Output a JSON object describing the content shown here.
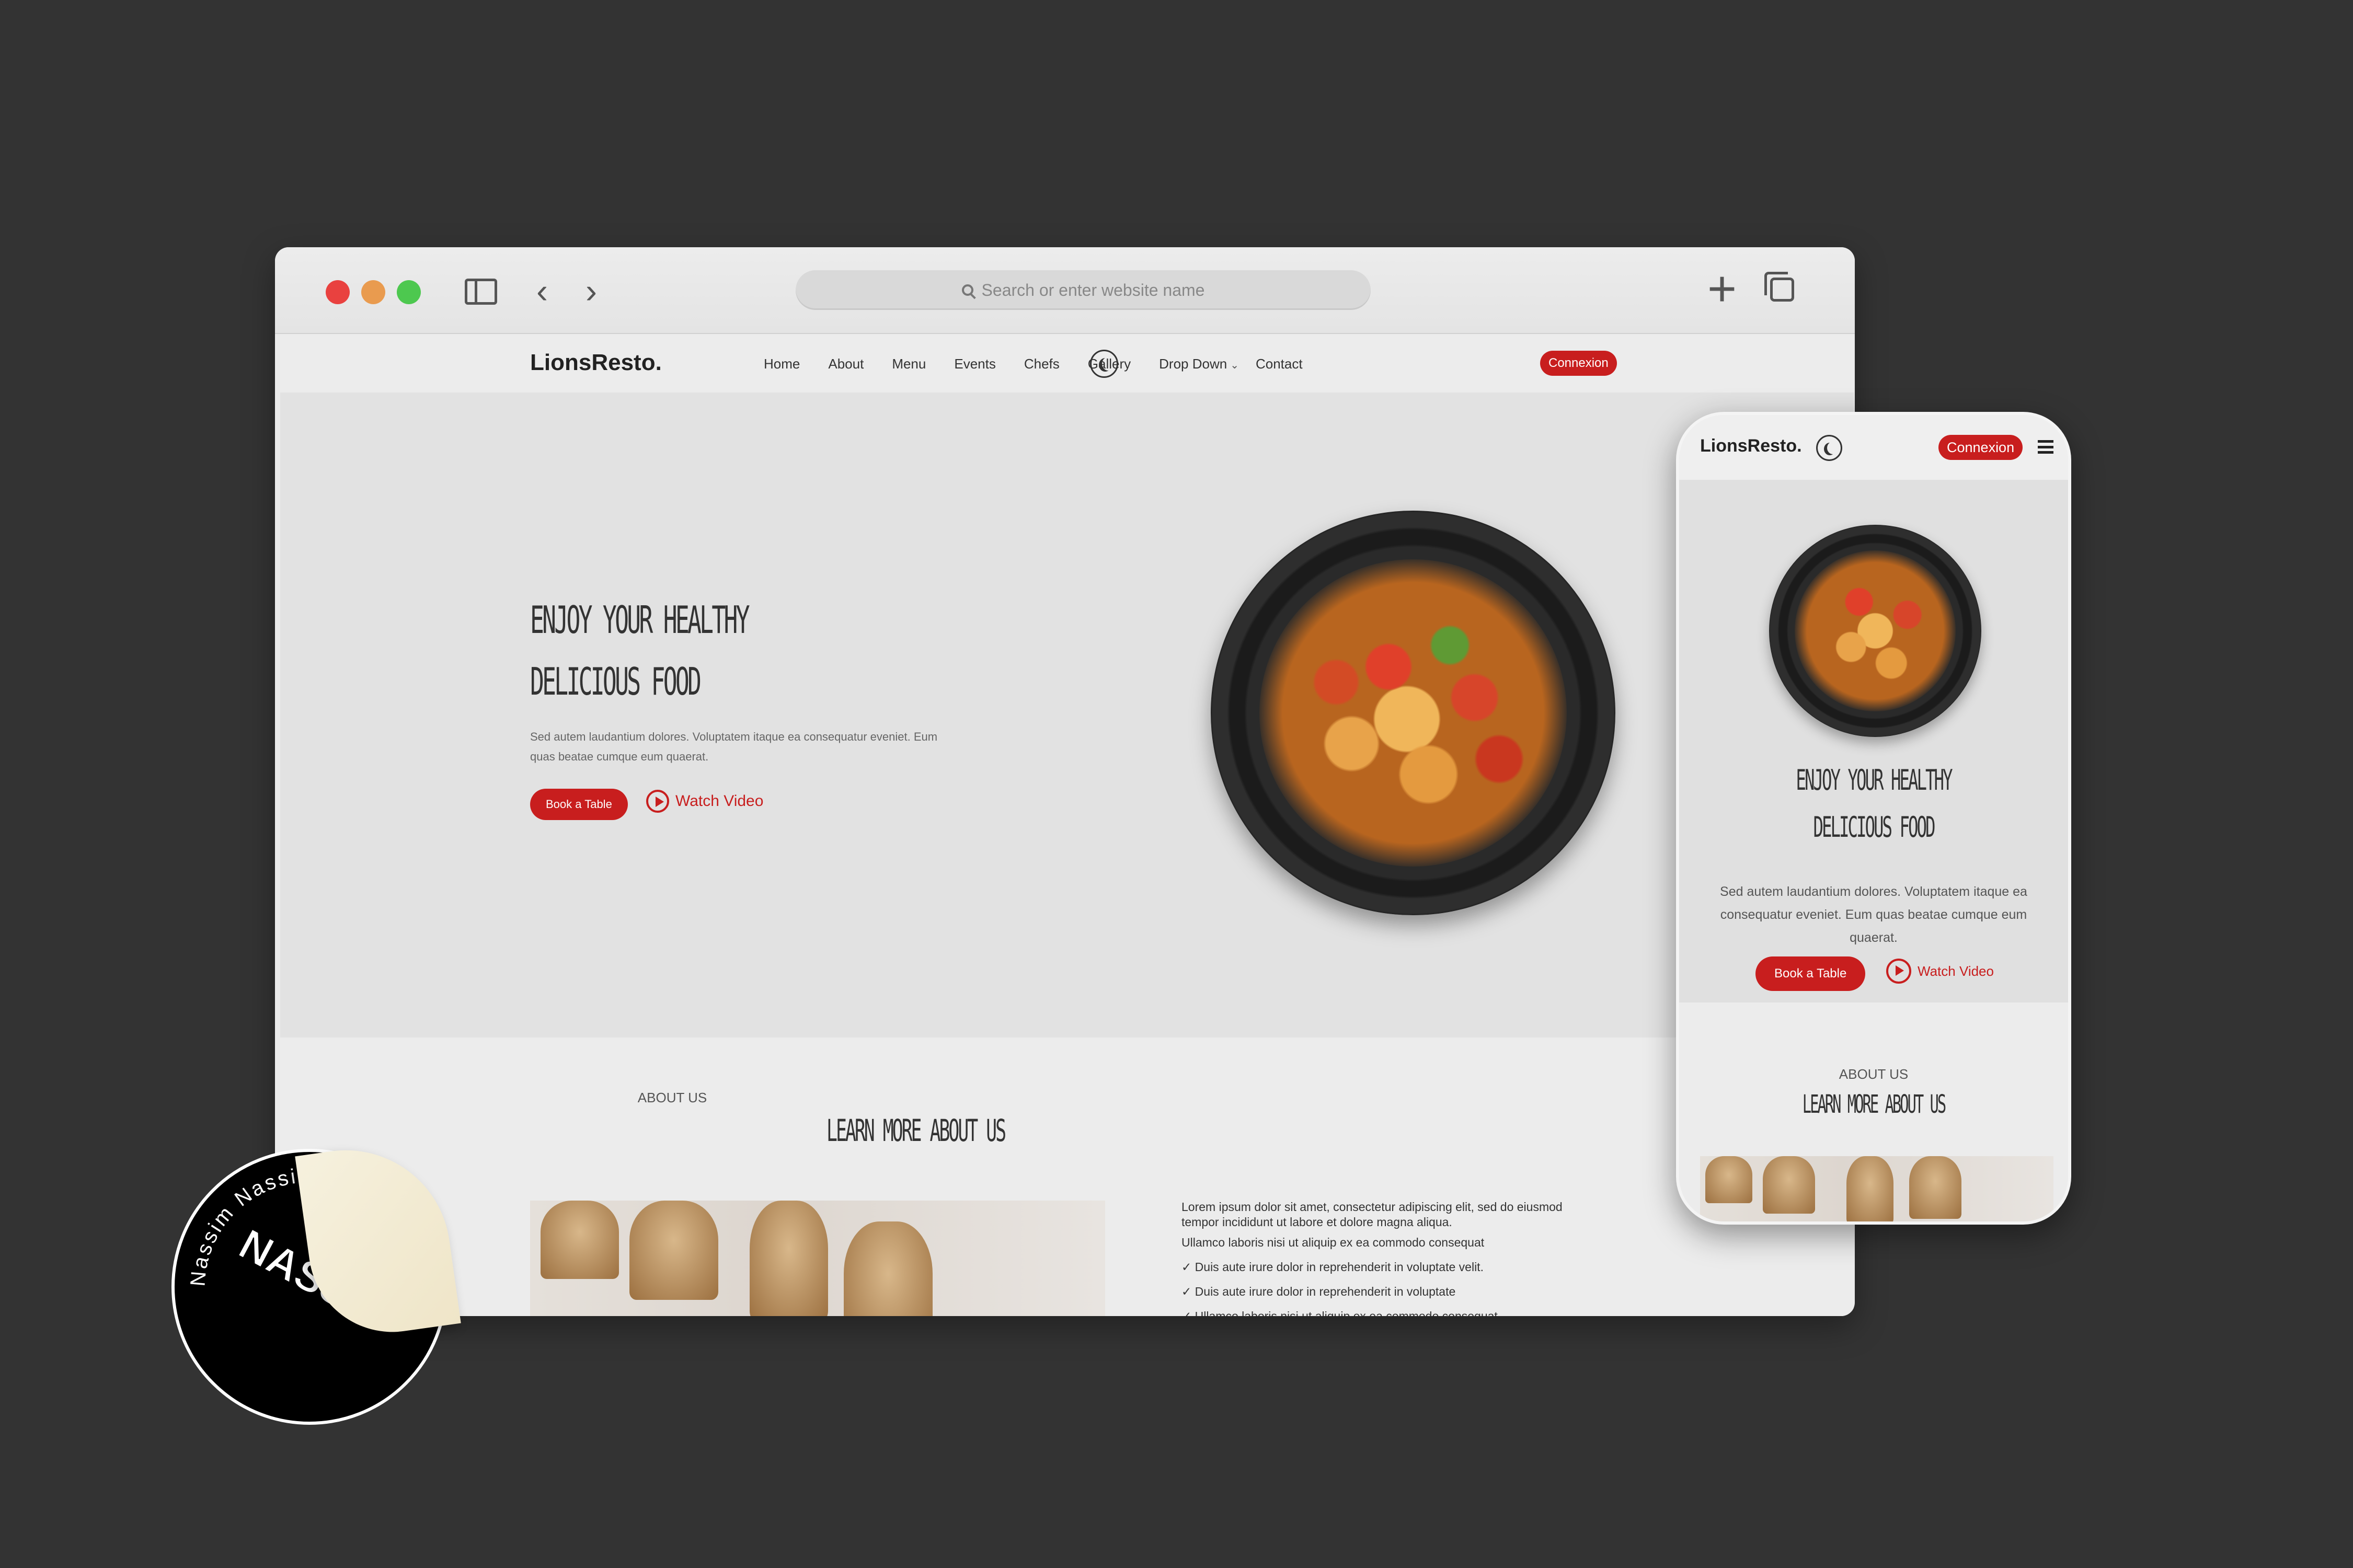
{
  "browser": {
    "address_placeholder": "Search or enter website name",
    "icons": [
      "sidebar-icon",
      "chevron-left-icon",
      "chevron-right-icon",
      "search-icon",
      "plus-icon",
      "tabs-icon"
    ]
  },
  "site": {
    "logo": "LionsResto.",
    "nav": [
      "Home",
      "About",
      "Menu",
      "Events",
      "Chefs",
      "Gallery",
      "Drop Down",
      "Contact"
    ],
    "connexion": "Connexion"
  },
  "hero": {
    "title_line1": "Enjoy Your Healthy",
    "title_line2": "Delicious Food",
    "text": "Sed autem laudantium dolores. Voluptatem itaque ea consequatur eveniet. Eum quas beatae cumque eum quaerat.",
    "book_label": "Book a Table",
    "watch_label": "Watch Video"
  },
  "about": {
    "label": "ABOUT US",
    "title": "Learn More About Us",
    "paragraph": "Lorem ipsum dolor sit amet, consectetur adipiscing elit, sed do eiusmod tempor incididunt ut labore et dolore magna aliqua.",
    "line2": "Ullamco laboris nisi ut aliquip ex ea commodo consequat",
    "check1": "✓ Duis aute irure dolor in reprehenderit in voluptate velit.",
    "check2": "✓ Duis aute irure dolor in reprehenderit in voluptate",
    "check3": "✓ Ullamco laboris nisi ut aliquip ex ea commodo consequat"
  },
  "mobile": {
    "logo": "LionsResto.",
    "connexion": "Connexion",
    "title_line1": "Enjoy Your Healthy",
    "title_line2": "Delicious Food",
    "text": "Sed autem laudantium dolores. Voluptatem itaque ea consequatur eveniet. Eum quas beatae cumque eum quaerat.",
    "book_label": "Book a Table",
    "watch_label": "Watch Video",
    "about_label": "ABOUT US",
    "about_title": "Learn More About Us"
  },
  "sticker": {
    "ring_text": "Nassim Nassim Nassim Nassim",
    "mark": "NASSIM"
  },
  "colors": {
    "accent": "#c81e1e",
    "background": "#333333"
  }
}
